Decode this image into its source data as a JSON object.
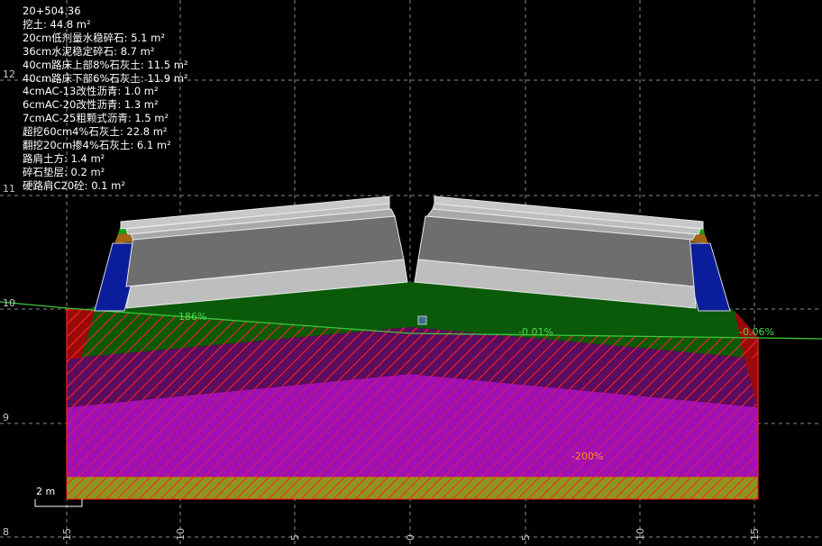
{
  "station": "20+504.36",
  "quantities": [
    "挖土: 44.8 m²",
    "20cm低剂量水稳碎石: 5.1 m²",
    "36cm水泥稳定碎石: 8.7 m²",
    "40cm路床上部8%石灰土: 11.5 m²",
    "40cm路床下部6%石灰土: 11.9 m²",
    "4cmAC-13改性沥青: 1.0 m²",
    "6cmAC-20改性沥青: 1.3 m²",
    "7cmAC-25粗颗式沥青: 1.5 m²",
    "超挖60cm4%石灰土: 22.8 m²",
    "翻挖20cm掺4%石灰土: 6.1 m²",
    "路肩土方: 1.4 m²",
    "碎石垫层: 0.2 m²",
    "硬路肩C20砼: 0.1 m²"
  ],
  "elevation_labels": [
    "12",
    "11",
    "10",
    "9",
    "8"
  ],
  "offset_labels": [
    "15",
    "10",
    "5",
    "0",
    "5",
    "10",
    "15"
  ],
  "slope_labels": {
    "left_ground": "186%",
    "right_cross": "-0.01%",
    "right_ground": "-0.06%",
    "bottom": "-200%"
  },
  "scale_bar": "2 m",
  "colors": {
    "background": "#000000",
    "grid": "#8c8c8c",
    "ground_line": "#3cc83c",
    "subgrade_green": "#0a5a0a",
    "excavation_red": "#9b0a0a",
    "overexcavation_magenta": "#a010b4",
    "magenta_dark": "#5a0c5e",
    "gravel_cushion": "#8c961e",
    "pavement_grey": "#6e6e6e",
    "pavement_light": "#bebebe",
    "shoulder_blue": "#0a1e9b",
    "shoulder_green": "#16a016",
    "shoulder_brown": "#a06414",
    "slope_text_green": "#50dc50",
    "slope_text_orange": "#ff8c28",
    "text": "#ffffff"
  }
}
